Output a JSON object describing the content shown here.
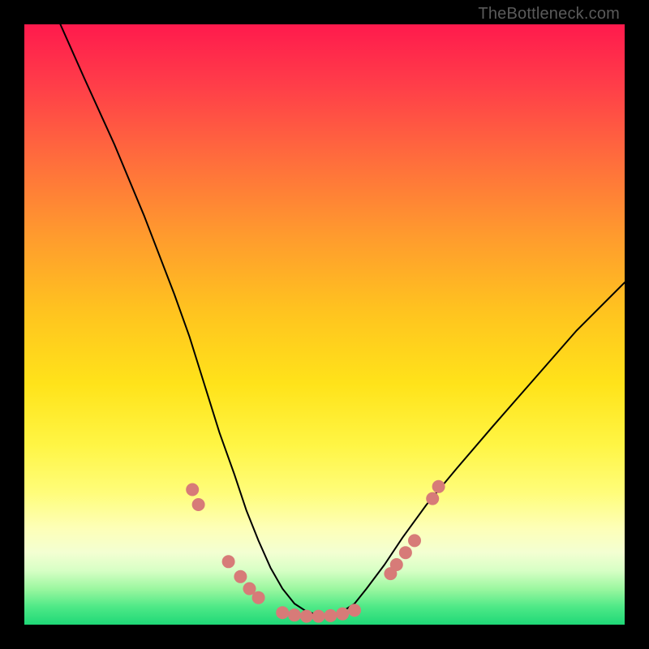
{
  "watermark": "TheBottleneck.com",
  "colors": {
    "curve_stroke": "#000000",
    "marker_fill": "#d77b78",
    "marker_stroke": "#d77b78",
    "plot_border": "#000000"
  },
  "chart_data": {
    "type": "line",
    "title": "",
    "xlabel": "",
    "ylabel": "",
    "xlim": [
      0,
      100
    ],
    "ylim": [
      0,
      100
    ],
    "series": [
      {
        "name": "bottleneck-curve",
        "x": [
          6,
          10,
          15,
          20,
          25,
          27.5,
          30,
          32.5,
          35,
          37,
          39,
          41,
          43,
          45,
          47,
          49,
          51,
          53,
          55,
          57,
          60,
          63,
          67,
          72,
          78,
          85,
          92,
          100
        ],
        "y": [
          100,
          91,
          80,
          68,
          55,
          48,
          40,
          32,
          25,
          19,
          14,
          9.5,
          6,
          3.5,
          2.2,
          1.6,
          1.6,
          2.2,
          3.5,
          6,
          10,
          14.5,
          20,
          26,
          33,
          41,
          49,
          57
        ]
      }
    ],
    "markers": [
      {
        "x": 28.0,
        "y": 22.5
      },
      {
        "x": 29.0,
        "y": 20.0
      },
      {
        "x": 34.0,
        "y": 10.5
      },
      {
        "x": 36.0,
        "y": 8.0
      },
      {
        "x": 37.5,
        "y": 6.0
      },
      {
        "x": 39.0,
        "y": 4.5
      },
      {
        "x": 43.0,
        "y": 2.0
      },
      {
        "x": 45.0,
        "y": 1.6
      },
      {
        "x": 47.0,
        "y": 1.4
      },
      {
        "x": 49.0,
        "y": 1.4
      },
      {
        "x": 51.0,
        "y": 1.5
      },
      {
        "x": 53.0,
        "y": 1.8
      },
      {
        "x": 55.0,
        "y": 2.4
      },
      {
        "x": 61.0,
        "y": 8.5
      },
      {
        "x": 62.0,
        "y": 10.0
      },
      {
        "x": 63.5,
        "y": 12.0
      },
      {
        "x": 65.0,
        "y": 14.0
      },
      {
        "x": 68.0,
        "y": 21.0
      },
      {
        "x": 69.0,
        "y": 23.0
      }
    ]
  }
}
